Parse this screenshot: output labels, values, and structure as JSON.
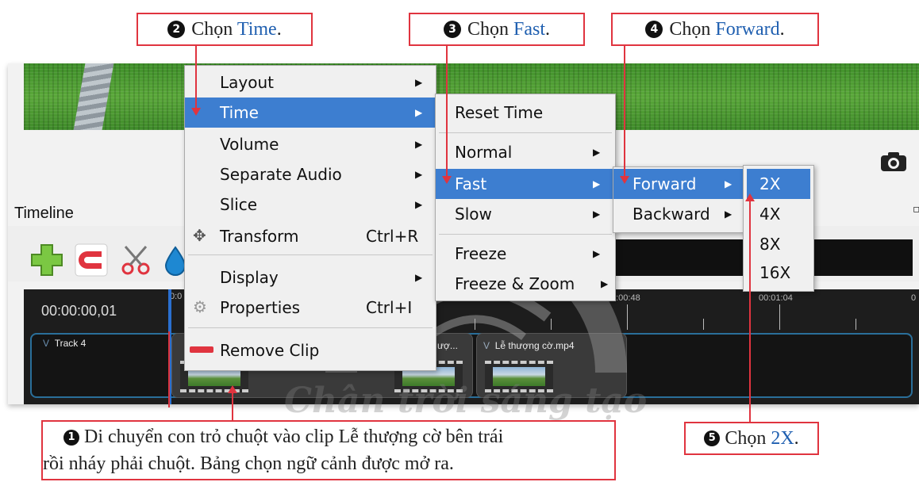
{
  "callouts": {
    "step2": {
      "num": "2",
      "prefix": "Chọn ",
      "highlight": "Time",
      "suffix": "."
    },
    "step3": {
      "num": "3",
      "prefix": "Chọn ",
      "highlight": "Fast",
      "suffix": "."
    },
    "step4": {
      "num": "4",
      "prefix": "Chọn ",
      "highlight": "Forward",
      "suffix": "."
    },
    "step1": {
      "num": "1",
      "line1": "Di chuyển con trỏ chuột vào clip Lễ thượng cờ bên trái",
      "line2": "rồi nháy phải chuột. Bảng chọn ngữ cảnh được mở ra."
    },
    "step5": {
      "num": "5",
      "prefix": "Chọn ",
      "highlight": "2X",
      "suffix": "."
    }
  },
  "app": {
    "timeline_title": "Timeline",
    "timecode": "00:00:00,01",
    "ruler_labels": [
      "0:0",
      "0:00:48",
      "00:01:04",
      "0"
    ],
    "track_label": "Track 4",
    "clip1_title": "ượ...",
    "clip2_title": "Lễ thượng cờ.mp4",
    "camera_icon": "camera-icon"
  },
  "menu_main": {
    "items": [
      {
        "label": "Layout",
        "shortcut": "",
        "submenu": true
      },
      {
        "label": "Time",
        "shortcut": "",
        "submenu": true,
        "highlighted": true
      },
      {
        "label": "Volume",
        "shortcut": "",
        "submenu": true
      },
      {
        "label": "Separate Audio",
        "shortcut": "",
        "submenu": true
      },
      {
        "label": "Slice",
        "shortcut": "",
        "submenu": true
      },
      {
        "label": "Transform",
        "shortcut": "Ctrl+R",
        "submenu": false
      },
      {
        "label": "Display",
        "shortcut": "",
        "submenu": true
      },
      {
        "label": "Properties",
        "shortcut": "Ctrl+I",
        "submenu": false
      },
      {
        "label": "Remove Clip",
        "shortcut": "",
        "submenu": false
      }
    ]
  },
  "menu_time": {
    "items": [
      {
        "label": "Reset Time"
      },
      {
        "label": "Normal"
      },
      {
        "label": "Fast",
        "highlighted": true
      },
      {
        "label": "Slow"
      },
      {
        "label": "Freeze"
      },
      {
        "label": "Freeze & Zoom"
      }
    ]
  },
  "menu_fast": {
    "items": [
      {
        "label": "Forward",
        "highlighted": true
      },
      {
        "label": "Backward"
      }
    ]
  },
  "menu_speed": {
    "items": [
      {
        "label": "2X",
        "highlighted": true
      },
      {
        "label": "4X"
      },
      {
        "label": "8X"
      },
      {
        "label": "16X"
      }
    ]
  },
  "watermark_text": "Chân trời sáng tạo",
  "colors": {
    "callout_border": "#e0343f",
    "highlight_text": "#1f5fb0",
    "menu_highlight": "#3d7ed0",
    "menu_bg": "#f0f0f0"
  }
}
